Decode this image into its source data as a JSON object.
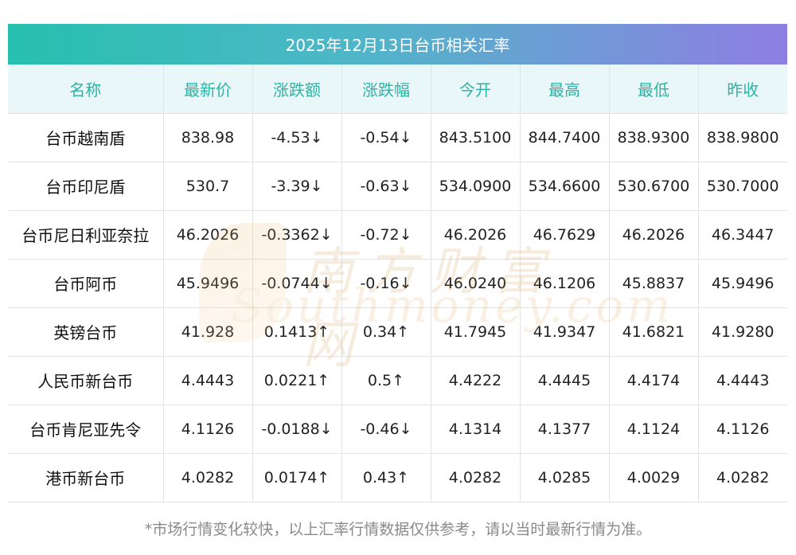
{
  "title": "2025年12月13日台币相关汇率",
  "headers": [
    "名称",
    "最新价",
    "涨跌额",
    "涨跌幅",
    "今开",
    "最高",
    "最低",
    "昨收"
  ],
  "rows": [
    {
      "name": "台币越南盾",
      "latest": "838.98",
      "change": "-4.53↓",
      "pct": "-0.54↓",
      "open": "843.5100",
      "high": "844.7400",
      "low": "838.9300",
      "prev": "838.9800",
      "dir": "down"
    },
    {
      "name": "台币印尼盾",
      "latest": "530.7",
      "change": "-3.39↓",
      "pct": "-0.63↓",
      "open": "534.0900",
      "high": "534.6600",
      "low": "530.6700",
      "prev": "530.7000",
      "dir": "down"
    },
    {
      "name": "台币尼日利亚奈拉",
      "latest": "46.2026",
      "change": "-0.3362↓",
      "pct": "-0.72↓",
      "open": "46.2026",
      "high": "46.7629",
      "low": "46.2026",
      "prev": "46.3447",
      "dir": "down"
    },
    {
      "name": "台币阿币",
      "latest": "45.9496",
      "change": "-0.0744↓",
      "pct": "-0.16↓",
      "open": "46.0240",
      "high": "46.1206",
      "low": "45.8837",
      "prev": "45.9496",
      "dir": "down"
    },
    {
      "name": "英镑台币",
      "latest": "41.928",
      "change": "0.1413↑",
      "pct": "0.34↑",
      "open": "41.7945",
      "high": "41.9347",
      "low": "41.6821",
      "prev": "41.9280",
      "dir": "up"
    },
    {
      "name": "人民币新台币",
      "latest": "4.4443",
      "change": "0.0221↑",
      "pct": "0.5↑",
      "open": "4.4222",
      "high": "4.4445",
      "low": "4.4174",
      "prev": "4.4443",
      "dir": "up"
    },
    {
      "name": "台币肯尼亚先令",
      "latest": "4.1126",
      "change": "-0.0188↓",
      "pct": "-0.46↓",
      "open": "4.1314",
      "high": "4.1377",
      "low": "4.1124",
      "prev": "4.1126",
      "dir": "down"
    },
    {
      "name": "港币新台币",
      "latest": "4.0282",
      "change": "0.0174↑",
      "pct": "0.43↑",
      "open": "4.0282",
      "high": "4.0285",
      "low": "4.0029",
      "prev": "4.0282",
      "dir": "up"
    }
  ],
  "watermark": {
    "cn": "南方财富网",
    "en": "Southmoney.com"
  },
  "footnote": "*市场行情变化较快，以上汇率行情数据仅供参考，请以当时最新行情为准。",
  "colors": {
    "up": "#e8141b",
    "down": "#1f8a1f",
    "header_text": "#2bb3a6"
  }
}
